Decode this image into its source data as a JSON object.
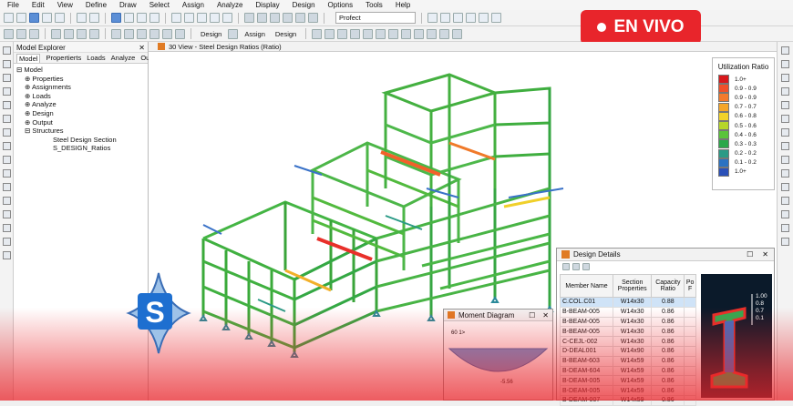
{
  "menu": [
    "File",
    "Edit",
    "View",
    "Define",
    "Draw",
    "Select",
    "Assign",
    "Analyze",
    "Display",
    "Design",
    "Options",
    "Tools",
    "Help"
  ],
  "toolbar": {
    "combo_value": "Profect",
    "design_label_1": "Design",
    "assign_label": "Assign",
    "design_label_2": "Design"
  },
  "live_badge": {
    "label": "EN VIVO"
  },
  "explorer": {
    "title": "Model Explorer",
    "tabs": [
      "Model",
      "Propertierts",
      "Loads",
      "Analyze",
      "Output"
    ],
    "tree": {
      "root": "Model",
      "items": [
        "Properties",
        "Assignments",
        "Loads",
        "Analyze",
        "Design",
        "Output",
        "Structures"
      ],
      "sub": [
        "Steel Design Section",
        "S_DESIGN_Ratios"
      ]
    }
  },
  "viewport": {
    "title": "30 View - Steel Design Ratios (Ratio)"
  },
  "legend": {
    "title": "Utilization Ratio",
    "rows": [
      {
        "label": "1.0+",
        "color": "#d8181c"
      },
      {
        "label": "0.9 - 0.9",
        "color": "#f0502a"
      },
      {
        "label": "0.9 - 0.9",
        "color": "#f47a2c"
      },
      {
        "label": "0.7 - 0.7",
        "color": "#f6a62a"
      },
      {
        "label": "0.6 - 0.8",
        "color": "#f2d22a"
      },
      {
        "label": "0.5 - 0.6",
        "color": "#b6d62a"
      },
      {
        "label": "0.4 - 0.6",
        "color": "#5ac43a"
      },
      {
        "label": "0.3 - 0.3",
        "color": "#2aa84a"
      },
      {
        "label": "0.2 - 0.2",
        "color": "#2a9a86"
      },
      {
        "label": "0.1 - 0.2",
        "color": "#2a72c2"
      },
      {
        "label": "1.0+",
        "color": "#2a50b8"
      }
    ]
  },
  "design_details": {
    "title": "Design Details",
    "headers": [
      "Member Name",
      "Section Properties",
      "Capacity Ratio",
      "Po F"
    ],
    "rows": [
      [
        "C.COL.C01",
        "W14x30",
        "0.88"
      ],
      [
        "B-BEAM-005",
        "W14x30",
        "0.86"
      ],
      [
        "B-BEAM-005",
        "W14x30",
        "0.86"
      ],
      [
        "B-BEAM-005",
        "W14x30",
        "0.86"
      ],
      [
        "C-CEJL-002",
        "W14x30",
        "0.86"
      ],
      [
        "D-DEAL001",
        "W14x90",
        "0.86"
      ],
      [
        "B-BEAM-603",
        "W14x59",
        "0.86"
      ],
      [
        "B-DEAM-604",
        "W14x59",
        "0.86"
      ],
      [
        "B-DEAM-005",
        "W14x59",
        "0.86"
      ],
      [
        "B-DEAM-005",
        "W14x59",
        "0.86"
      ],
      [
        "B-DEAM-007",
        "W14x59",
        "0.86"
      ]
    ],
    "section_scale": [
      "1.00",
      "0.8",
      "0.7",
      "0.1"
    ]
  },
  "moment": {
    "title": "Moment Diagram",
    "top_value": "60 1>",
    "bottom_value": "-5.56"
  },
  "logo": {
    "letter": "S"
  },
  "colors": {
    "accent": "#e8252b",
    "panel_icon": "#e07b24"
  }
}
